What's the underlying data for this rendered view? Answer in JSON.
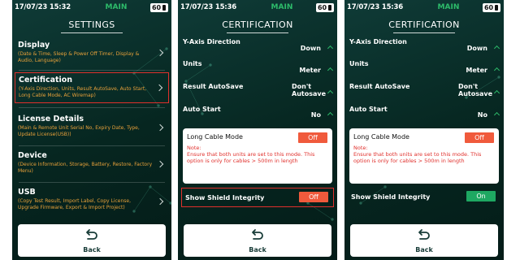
{
  "status": {
    "time1": "17/07/23 15:32",
    "time2": "17/07/23 15:36",
    "mode": "MAIN",
    "battery": "60"
  },
  "settings": {
    "title": "SETTINGS",
    "items": [
      {
        "title": "Display",
        "desc": "(Date & Time, Sleep & Power Off Timer, Display & Audio, Language)"
      },
      {
        "title": "Certification",
        "desc": "(Y-Axis Direction, Units, Result AutoSave, Auto Start, Long Cable Mode, AC Wiremap)"
      },
      {
        "title": "License Details",
        "desc": "(Main & Remote Unit Serial No, Expiry Date, Type, Update License(USB))"
      },
      {
        "title": "Device",
        "desc": "(Device Information, Storage, Battery, Restore, Factory Menu)"
      },
      {
        "title": "USB",
        "desc": "(Copy Test Result, Import Label, Copy License, Upgrade Firmware, Export & Import Project)"
      }
    ]
  },
  "cert": {
    "title": "CERTIFICATION",
    "rows": [
      {
        "label": "Y-Axis Direction",
        "value": "Down"
      },
      {
        "label": "Units",
        "value": "Meter"
      },
      {
        "label": "Result AutoSave",
        "value": "Don't Autosave"
      },
      {
        "label": "Auto Start",
        "value": "No"
      }
    ],
    "long_cable": {
      "label": "Long Cable Mode",
      "toggle": "Off",
      "note_title": "Note:",
      "note": "Ensure that both units are set to this mode. This option is only for cables > 500m in length"
    },
    "shield": {
      "label": "Show Shield Integrity",
      "toggle_off": "Off",
      "toggle_on": "On"
    }
  },
  "back_label": "Back",
  "colors": {
    "accent": "#2dbb6a",
    "warn": "#e0302c",
    "orange": "#e8a13a",
    "bg": "#062620"
  }
}
